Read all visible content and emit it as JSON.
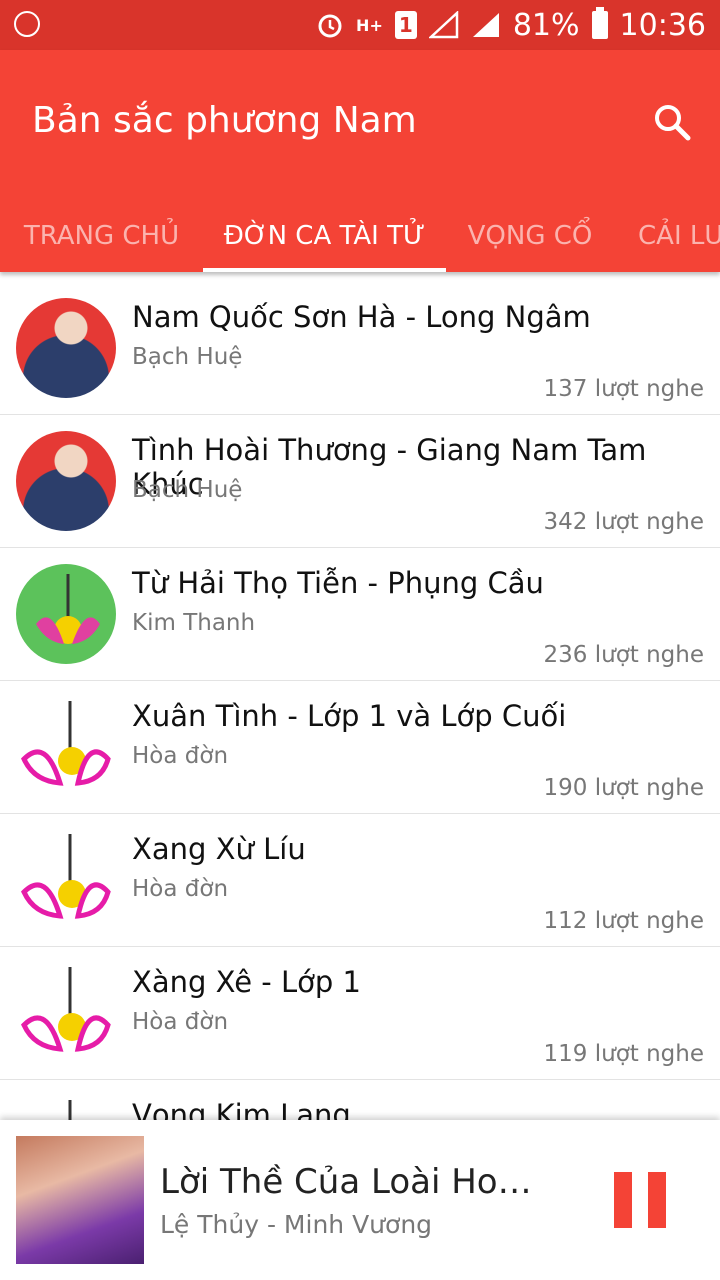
{
  "status": {
    "battery": "81%",
    "time": "10:36",
    "sim_label": "1",
    "network": "H+"
  },
  "app": {
    "title": "Bản sắc phương Nam",
    "accent": "#f44336"
  },
  "tabs": [
    {
      "label": "TRANG CHỦ",
      "active": false
    },
    {
      "label": "ĐỜN CA TÀI TỬ",
      "active": true
    },
    {
      "label": "VỌNG CỔ",
      "active": false
    },
    {
      "label": "CẢI LƯƠNG",
      "active": false
    }
  ],
  "songs": [
    {
      "title": "Nam Quốc Sơn Hà - Long Ngâm",
      "artist": "Bạch Huệ",
      "plays": "137 lượt nghe",
      "thumb": "singer-photo"
    },
    {
      "title": "Tình Hoài Thương - Giang Nam Tam Khúc",
      "artist": "Bạch Huệ",
      "plays": "342 lượt nghe",
      "thumb": "singer-photo"
    },
    {
      "title": "Từ Hải Thọ Tiễn - Phụng Cầu",
      "artist": "Kim Thanh",
      "plays": "236 lượt nghe",
      "thumb": "green-lotus-logo"
    },
    {
      "title": "Xuân Tình - Lớp 1 và Lớp Cuối",
      "artist": "Hòa đờn",
      "plays": "190 lượt nghe",
      "thumb": "lotus-logo"
    },
    {
      "title": "Xang Xừ Líu",
      "artist": "Hòa đờn",
      "plays": "112 lượt nghe",
      "thumb": "lotus-logo"
    },
    {
      "title": "Xàng Xê - Lớp 1",
      "artist": "Hòa đờn",
      "plays": "119 lượt nghe",
      "thumb": "lotus-logo"
    },
    {
      "title": "Vọng Kim Lang",
      "artist": "",
      "plays": "",
      "thumb": "lotus-logo"
    }
  ],
  "player": {
    "title": "Lời Thề Của Loài Hoa...",
    "artist": "Lệ Thủy - Minh Vương",
    "state": "playing"
  }
}
